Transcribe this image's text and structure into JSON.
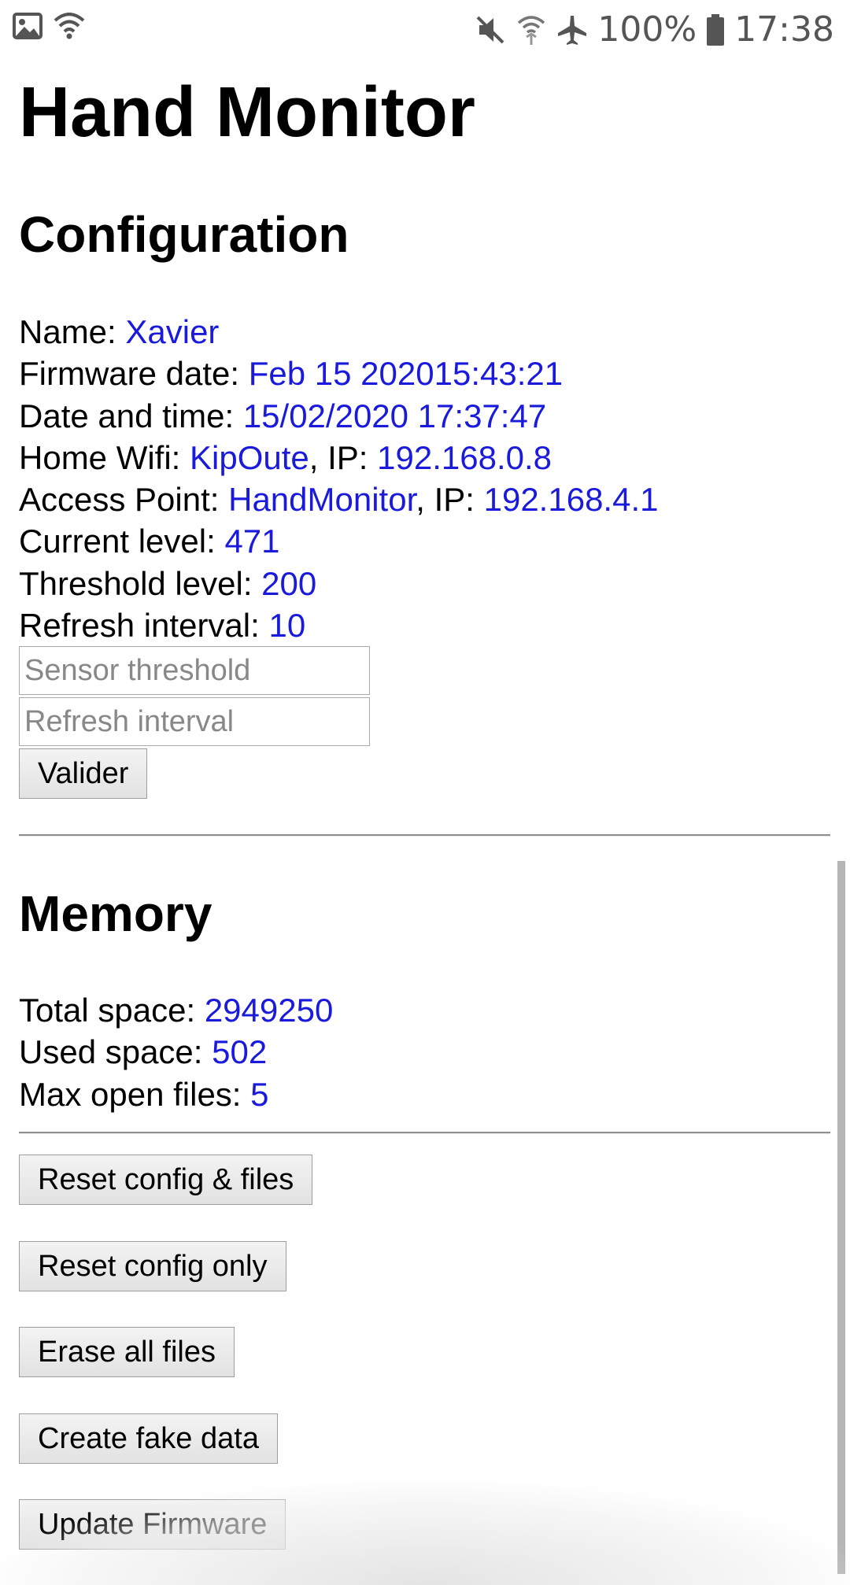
{
  "status_bar": {
    "battery": "100%",
    "time": "17:38",
    "icons": [
      "image-icon",
      "wifi-icon",
      "mute-icon",
      "wifi-calling-icon",
      "airplane-mode-icon",
      "battery-icon"
    ]
  },
  "page": {
    "title": "Hand Monitor"
  },
  "configuration": {
    "heading": "Configuration",
    "name_label": "Name: ",
    "name": "Xavier",
    "firmware_label": "Firmware date: ",
    "firmware_date": "Feb 15 202015:43:21",
    "datetime_label": "Date and time: ",
    "datetime": "15/02/2020 17:37:47",
    "home_wifi_label": "Home Wifi: ",
    "home_wifi": "KipOute",
    "ip_label": ", IP: ",
    "home_ip": "192.168.0.8",
    "ap_label": "Access Point: ",
    "ap_name": "HandMonitor",
    "ap_ip": "192.168.4.1",
    "current_level_label": "Current level: ",
    "current_level": "471",
    "threshold_label": "Threshold level: ",
    "threshold": "200",
    "refresh_label": "Refresh interval: ",
    "refresh": "10",
    "sensor_threshold_placeholder": "Sensor threshold",
    "refresh_interval_placeholder": "Refresh interval",
    "submit_label": "Valider"
  },
  "memory": {
    "heading": "Memory",
    "total_label": "Total space: ",
    "total": "2949250",
    "used_label": "Used space: ",
    "used": "502",
    "max_files_label": "Max open files: ",
    "max_files": "5"
  },
  "actions": {
    "reset_all": "Reset config & files",
    "reset_config": "Reset config only",
    "erase_files": "Erase all files",
    "fake_data": "Create fake data",
    "update_firmware": "Update Firmware"
  },
  "colors": {
    "value": "#1a1add",
    "status_icons": "#555555"
  }
}
